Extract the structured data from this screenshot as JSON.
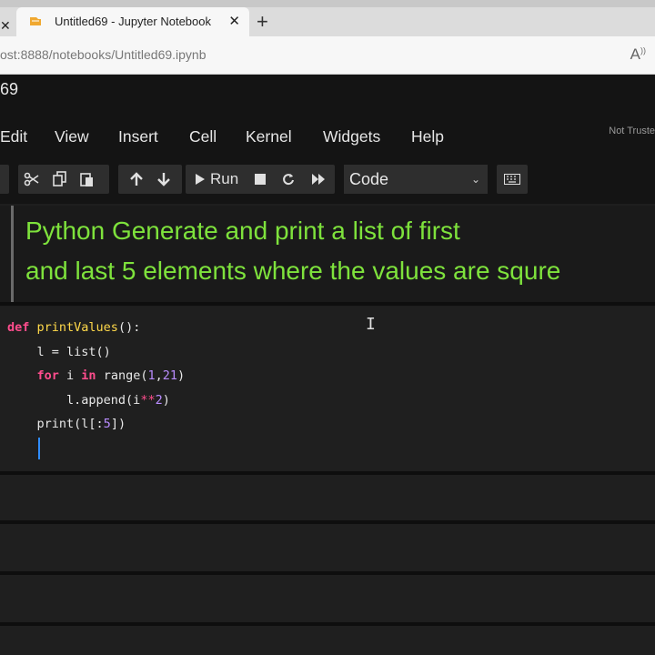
{
  "browser": {
    "tab_title": "Untitled69 - Jupyter Notebook",
    "left_close": "✕",
    "tab_close": "✕",
    "new_tab": "+",
    "url_dim": "ost",
    "url_main": ":8888/notebooks/Untitled69.ipynb",
    "read_aloud": "A",
    "favicon_color": "#f0a830"
  },
  "notebook": {
    "title_fragment": "69",
    "trust_status": "Not Truste"
  },
  "menu": {
    "items": [
      "Edit",
      "View",
      "Insert",
      "Cell",
      "Kernel",
      "Widgets",
      "Help"
    ]
  },
  "toolbar": {
    "run_label": "Run",
    "cell_type": "Code",
    "icons": [
      "cut-icon",
      "copy-icon",
      "paste-icon",
      "move-up-icon",
      "move-down-icon",
      "run-icon",
      "stop-icon",
      "restart-icon",
      "fast-forward-icon",
      "keyboard-icon"
    ]
  },
  "markdown_cell": {
    "line1": "Python Generate and print a list of first",
    "line2": "and last 5 elements where the values are squre",
    "text_color": "#7ee23c"
  },
  "code_cell": {
    "lines": [
      {
        "kw": "def",
        "fn": "printValues",
        "rest": "():"
      },
      {
        "text": "    l = list()"
      },
      {
        "kw": "for",
        "a": " i ",
        "kw2": "in",
        "b": " range(",
        "n1": "1",
        "c": ",",
        "n2": "21",
        "d": ")"
      },
      {
        "text": "        l.append(i",
        "op": "**",
        "n": "2",
        "e": ")"
      },
      {
        "text": "    print(l[:",
        "n": "5",
        "e": "])"
      }
    ]
  }
}
